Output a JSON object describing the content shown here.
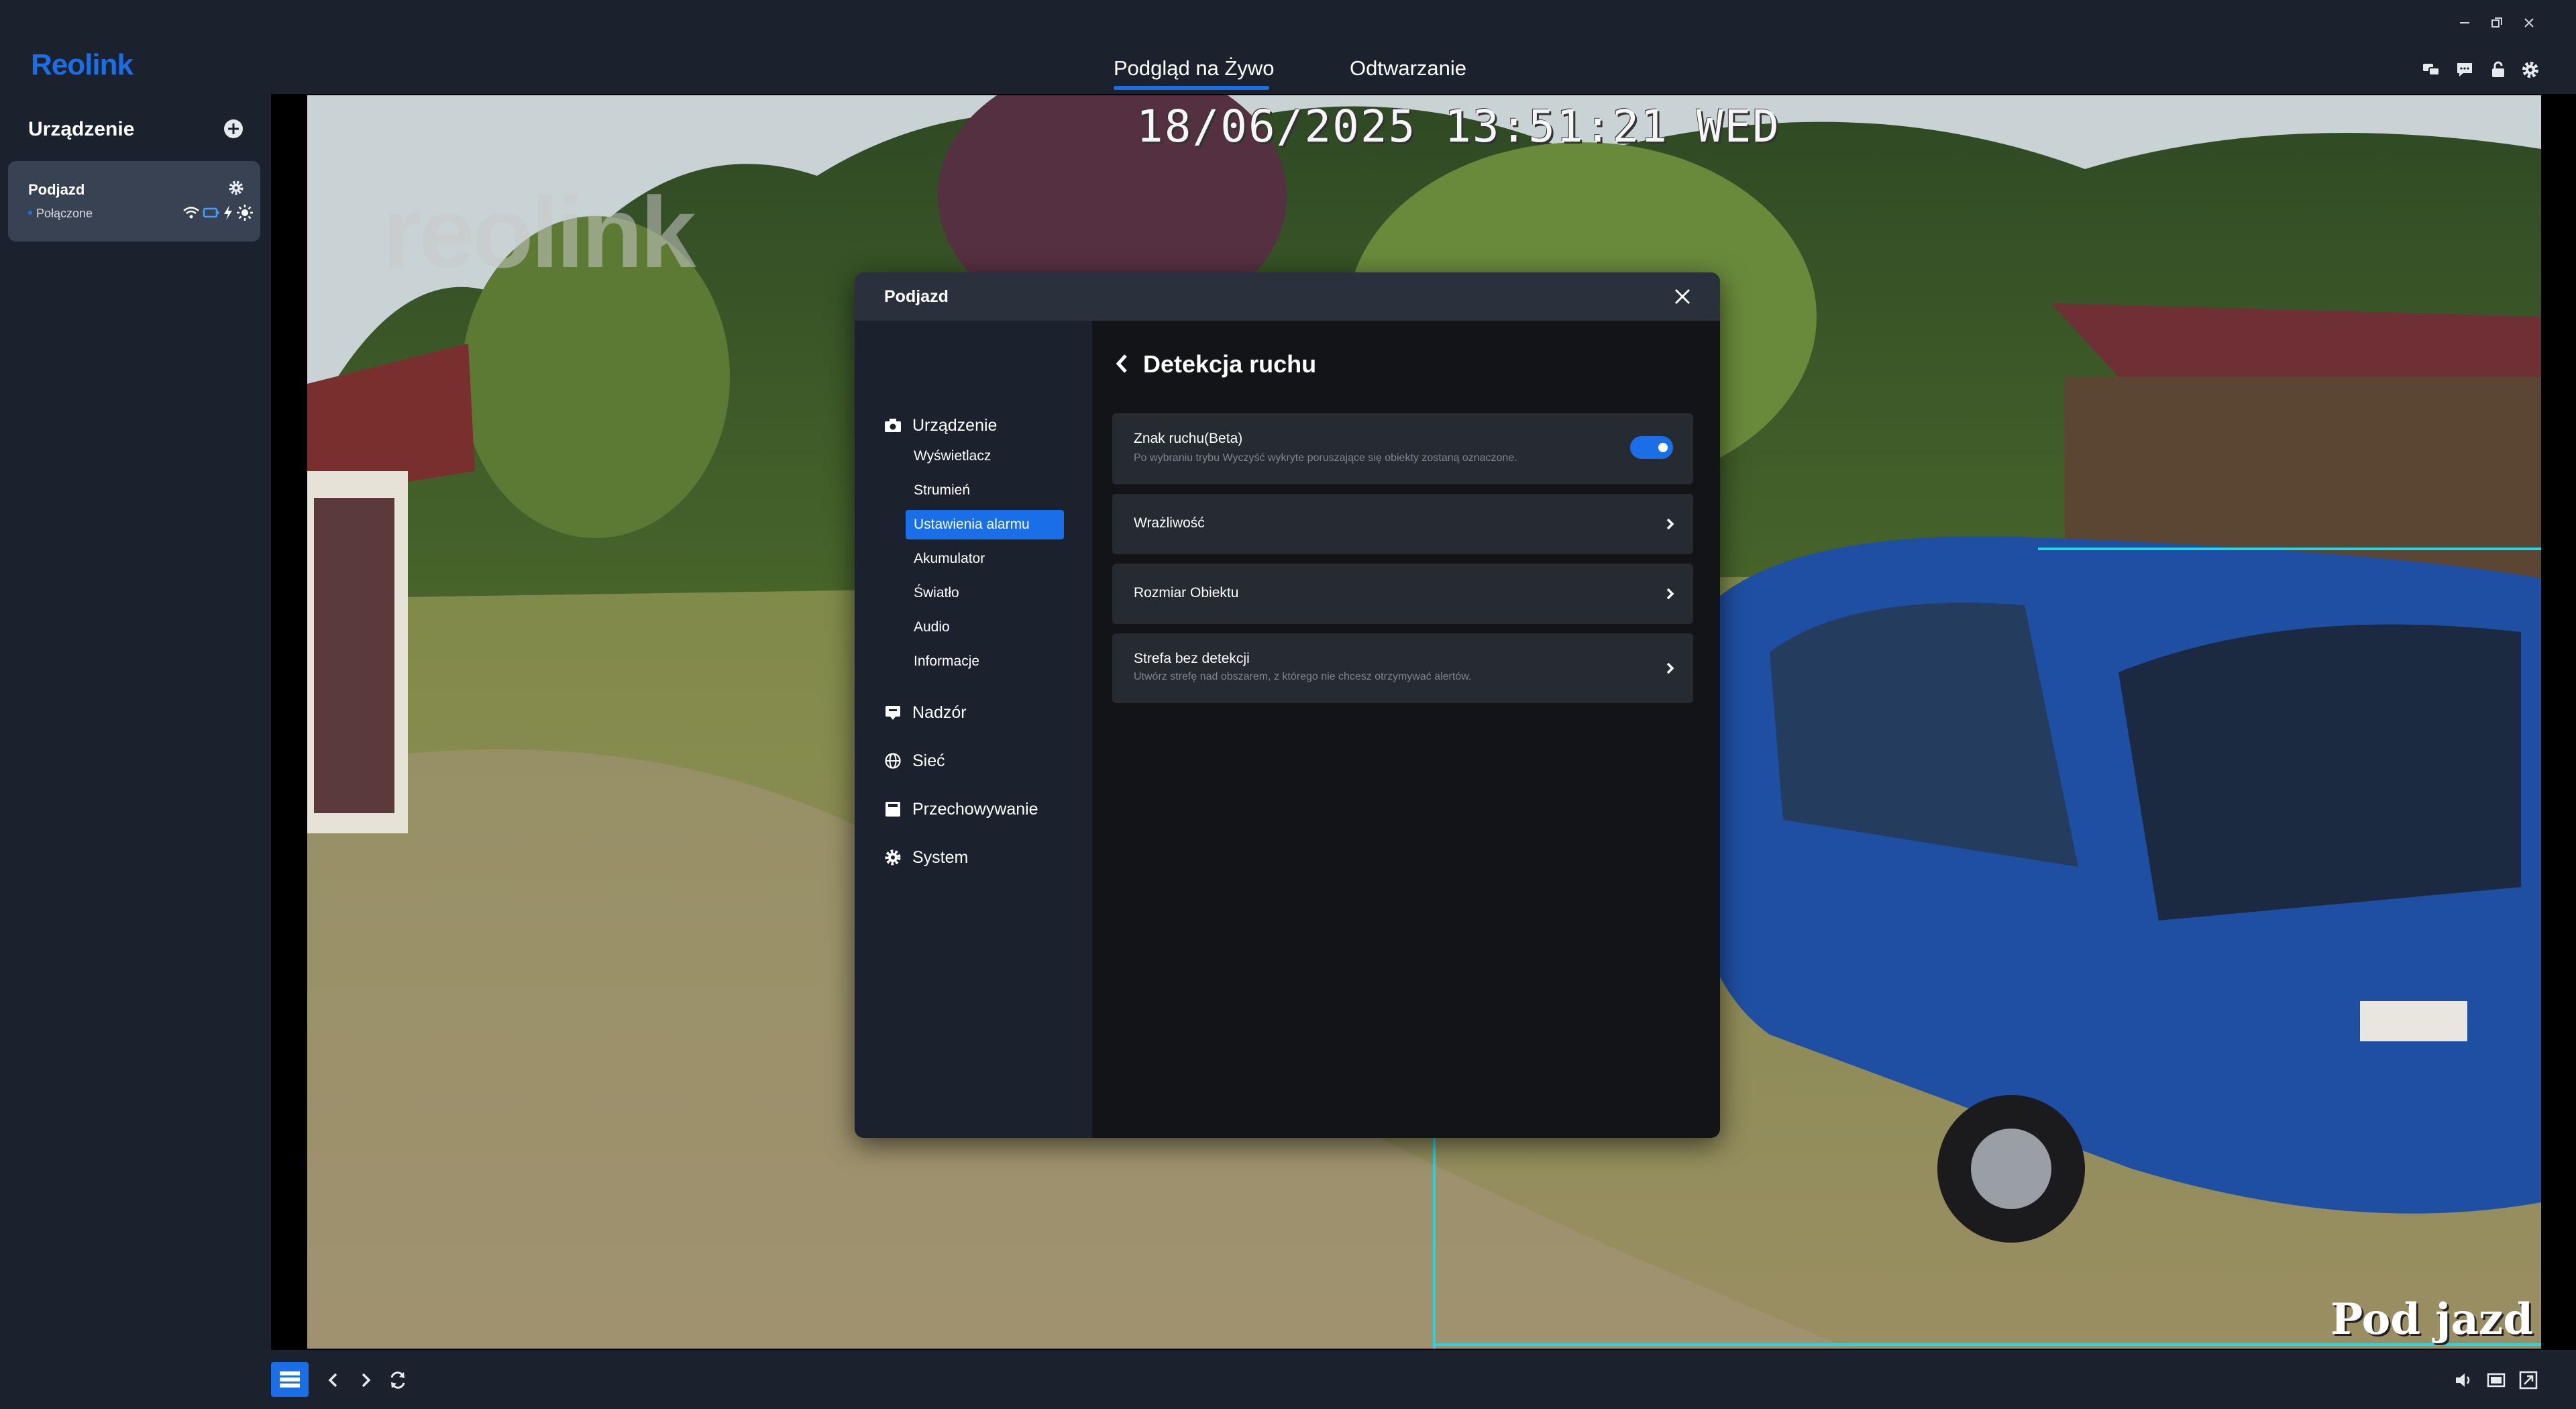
{
  "app": {
    "brand": "Reolink",
    "tabs": [
      {
        "label": "Podgląd na Żywo",
        "active": true
      },
      {
        "label": "Odtwarzanie",
        "active": false
      }
    ],
    "top_icons": [
      "chat-bubbles-icon",
      "message-icon",
      "lock-icon",
      "settings-icon"
    ],
    "window_controls": [
      "minimize-icon",
      "restore-icon",
      "close-icon"
    ],
    "accent_color": "#1a6fe8"
  },
  "sidebar": {
    "header": "Urządzenie",
    "devices": [
      {
        "name": "Podjazd",
        "status": "Połączone",
        "icons": [
          "wifi-icon",
          "battery-icon",
          "charging-icon",
          "sun-icon"
        ]
      }
    ]
  },
  "camera": {
    "timestamp": "18/06/2025 13:51:21 WED",
    "watermark": "reolink",
    "label": "Pod jazd"
  },
  "modal": {
    "title": "Podjazd",
    "nav": {
      "sections": [
        {
          "label": "Urządzenie",
          "icon": "camera-icon"
        },
        {
          "label": "Nadzór",
          "icon": "monitor-icon"
        },
        {
          "label": "Sieć",
          "icon": "globe-icon"
        },
        {
          "label": "Przechowywanie",
          "icon": "storage-icon"
        },
        {
          "label": "System",
          "icon": "gear-icon"
        }
      ],
      "sub_items": [
        {
          "label": "Wyświetlacz",
          "active": false
        },
        {
          "label": "Strumień",
          "active": false
        },
        {
          "label": "Ustawienia alarmu",
          "active": true
        },
        {
          "label": "Akumulator",
          "active": false
        },
        {
          "label": "Światło",
          "active": false
        },
        {
          "label": "Audio",
          "active": false
        },
        {
          "label": "Informacje",
          "active": false
        }
      ]
    },
    "content": {
      "title": "Detekcja ruchu",
      "rows": [
        {
          "title": "Znak ruchu(Beta)",
          "desc": "Po wybraniu trybu Wyczyść wykryte poruszające się obiekty zostaną oznaczone.",
          "toggle": true
        },
        {
          "title": "Wrażliwość",
          "desc": ""
        },
        {
          "title": "Rozmiar Obiektu",
          "desc": ""
        },
        {
          "title": "Strefa bez detekcji",
          "desc": "Utwórz strefę nad obszarem, z którego nie chcesz otrzymywać alertów."
        }
      ]
    }
  },
  "bottombar": {
    "left_icons": [
      "layout-icon",
      "prev-icon",
      "next-icon",
      "refresh-icon"
    ],
    "right_icons": [
      "volume-icon",
      "aspect-icon",
      "fullscreen-icon"
    ]
  }
}
